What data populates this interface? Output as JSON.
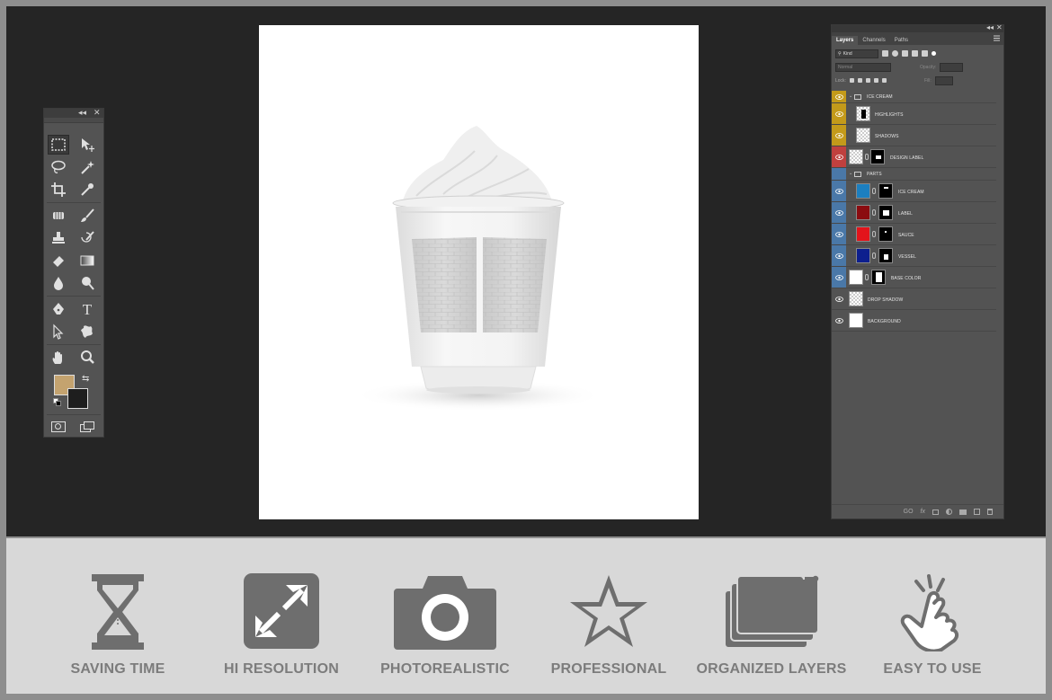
{
  "tools_panel": {
    "collapse_glyph": "◂◂",
    "close_glyph": "✕",
    "foreground_color": "#c4a36f",
    "background_color": "#1e1e1e",
    "tools": [
      {
        "name": "marquee-tool",
        "icon": "rect-marquee-icon"
      },
      {
        "name": "move-tool",
        "icon": "move-icon"
      },
      {
        "name": "lasso-tool",
        "icon": "lasso-icon"
      },
      {
        "name": "magic-wand-tool",
        "icon": "magic-wand-icon"
      },
      {
        "name": "crop-tool",
        "icon": "crop-icon"
      },
      {
        "name": "eyedropper-tool",
        "icon": "eyedropper-icon"
      },
      {
        "name": "healing-tool",
        "icon": "healing-icon"
      },
      {
        "name": "brush-tool",
        "icon": "brush-icon"
      },
      {
        "name": "stamp-tool",
        "icon": "stamp-icon"
      },
      {
        "name": "history-brush-tool",
        "icon": "history-brush-icon"
      },
      {
        "name": "eraser-tool",
        "icon": "eraser-icon"
      },
      {
        "name": "gradient-tool",
        "icon": "gradient-icon"
      },
      {
        "name": "blur-tool",
        "icon": "blur-icon"
      },
      {
        "name": "dodge-tool",
        "icon": "dodge-icon"
      },
      {
        "name": "pen-tool",
        "icon": "pen-icon"
      },
      {
        "name": "type-tool",
        "icon": "type-icon"
      },
      {
        "name": "path-select-tool",
        "icon": "path-select-icon"
      },
      {
        "name": "shape-tool",
        "icon": "shape-icon"
      },
      {
        "name": "hand-tool",
        "icon": "hand-icon"
      },
      {
        "name": "zoom-tool",
        "icon": "zoom-icon"
      }
    ],
    "type_glyph": "T"
  },
  "layers_panel": {
    "collapse_glyph": "◂◂",
    "close_glyph": "✕",
    "tabs": [
      "Layers",
      "Channels",
      "Paths"
    ],
    "filter_kind": "Kind",
    "blend_mode": "Normal",
    "opacity_label": "Opacity:",
    "lock_label": "Lock:",
    "fill_label": "Fill:",
    "layers": [
      {
        "name": "ICE CREAM",
        "kind": "group",
        "color": "#c39a1a"
      },
      {
        "name": "HIGHLIGHTS",
        "kind": "layer",
        "color": "#c39a1a"
      },
      {
        "name": "SHADOWS",
        "kind": "layer",
        "color": "#c39a1a"
      },
      {
        "name": "DESIGN LABEL",
        "kind": "smart",
        "color": "#c0403e"
      },
      {
        "name": "PARTS",
        "kind": "group",
        "color": "#4a78a8"
      },
      {
        "name": "ICE CREAM",
        "kind": "layer",
        "color": "#4a78a8",
        "fill": "#1c7fc0"
      },
      {
        "name": "LABEL",
        "kind": "layer",
        "color": "#4a78a8",
        "fill": "#8b0c10"
      },
      {
        "name": "SAUCE",
        "kind": "layer",
        "color": "#4a78a8",
        "fill": "#e3141b"
      },
      {
        "name": "VESSEL",
        "kind": "layer",
        "color": "#4a78a8",
        "fill": "#0d1f8e"
      },
      {
        "name": "BASE COLOR",
        "kind": "layer",
        "color": "#4a78a8",
        "fill": "#ffffff"
      },
      {
        "name": "DROP SHADOW",
        "kind": "layer",
        "color": "none"
      },
      {
        "name": "BACKGROUND",
        "kind": "layer",
        "color": "none",
        "fill": "#ffffff"
      }
    ],
    "bottom_glyphs": [
      "GO",
      "fx"
    ]
  },
  "features": [
    {
      "label": "SAVING TIME",
      "icon": "hourglass-icon"
    },
    {
      "label": "HI RESOLUTION",
      "icon": "expand-arrows-icon"
    },
    {
      "label": "PHOTOREALISTIC",
      "icon": "camera-icon"
    },
    {
      "label": "PROFESSIONAL",
      "icon": "star-icon"
    },
    {
      "label": "ORGANIZED LAYERS",
      "icon": "folders-icon"
    },
    {
      "label": "EASY TO USE",
      "icon": "tap-hand-icon"
    }
  ],
  "colors": {
    "workspace": "#252525",
    "panel": "#535353",
    "feature_icon": "#6e6e6e",
    "feature_label": "#7c7c7c"
  }
}
